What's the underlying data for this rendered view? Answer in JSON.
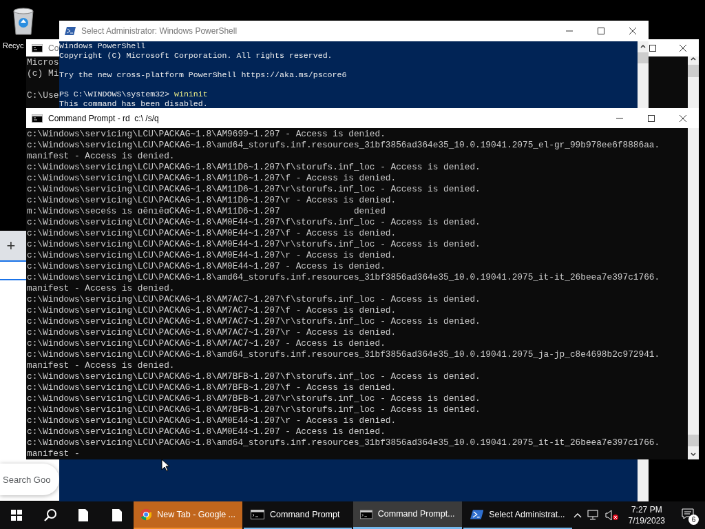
{
  "desktop_icons": [
    {
      "label": "Recyc"
    }
  ],
  "back_console": {
    "title": "Co",
    "lines": [
      {
        "kind": "text",
        "text": "Micros"
      },
      {
        "kind": "text",
        "text": "(c) Mi"
      },
      {
        "kind": "blank"
      },
      {
        "kind": "text",
        "text": "C:\\Use"
      }
    ]
  },
  "browser": {
    "new_tab": "+",
    "search_placeholder": "Search Goo"
  },
  "powershell": {
    "title": "Select Administrator: Windows PowerShell",
    "lines": [
      {
        "kind": "text",
        "text": "Windows PowerShell"
      },
      {
        "kind": "text",
        "text": "Copyright (C) Microsoft Corporation. All rights reserved."
      },
      {
        "kind": "blank"
      },
      {
        "kind": "text",
        "text": "Try the new cross-platform PowerShell https://aka.ms/pscore6"
      },
      {
        "kind": "blank"
      },
      {
        "kind": "prompt",
        "text": "PS C:\\WINDOWS\\system32> ",
        "command": "wininit"
      },
      {
        "kind": "text",
        "text": "This command has been disabled."
      }
    ]
  },
  "command_prompt": {
    "title": "Command Prompt - rd  c:\\ /s/q",
    "lines": [
      "c:\\Windows\\servicing\\LCU\\PACKAG~1.8\\AM9699~1.207 - Access is denied.",
      "c:\\Windows\\servicing\\LCU\\PACKAG~1.8\\amd64_storufs.inf.resources_31bf3856ad364e35_10.0.19041.2075_el-gr_99b978ee6f8886aa.",
      "manifest - Access is denied.",
      "c:\\Windows\\servicing\\LCU\\PACKAG~1.8\\AM11D6~1.207\\f\\storufs.inf_loc - Access is denied.",
      "c:\\Windows\\servicing\\LCU\\PACKAG~1.8\\AM11D6~1.207\\f - Access is denied.",
      "c:\\Windows\\servicing\\LCU\\PACKAG~1.8\\AM11D6~1.207\\r\\storufs.inf_loc - Access is denied.",
      "c:\\Windows\\servicing\\LCU\\PACKAG~1.8\\AM11D6~1.207\\r - Access is denied.",
      "m:\\Windows\\seceśs ıs ɑēnıēɑCKAG~1.8\\AM11D6~1.207              denied",
      "c:\\Windows\\servicing\\LCU\\PACKAG~1.8\\AM0E44~1.207\\f\\storufs.inf_loc - Access is denied.",
      "c:\\Windows\\servicing\\LCU\\PACKAG~1.8\\AM0E44~1.207\\f - Access is denied.",
      "c:\\Windows\\servicing\\LCU\\PACKAG~1.8\\AM0E44~1.207\\r\\storufs.inf_loc - Access is denied.",
      "c:\\Windows\\servicing\\LCU\\PACKAG~1.8\\AM0E44~1.207\\r - Access is denied.",
      "c:\\Windows\\servicing\\LCU\\PACKAG~1.8\\AM0E44~1.207 - Access is denied.",
      "c:\\Windows\\servicing\\LCU\\PACKAG~1.8\\amd64_storufs.inf.resources_31bf3856ad364e35_10.0.19041.2075_it-it_26beea7e397c1766.",
      "manifest - Access is denied.",
      "c:\\Windows\\servicing\\LCU\\PACKAG~1.8\\AM7AC7~1.207\\f\\storufs.inf_loc - Access is denied.",
      "c:\\Windows\\servicing\\LCU\\PACKAG~1.8\\AM7AC7~1.207\\f - Access is denied.",
      "c:\\Windows\\servicing\\LCU\\PACKAG~1.8\\AM7AC7~1.207\\r\\storufs.inf_loc - Access is denied.",
      "c:\\Windows\\servicing\\LCU\\PACKAG~1.8\\AM7AC7~1.207\\r - Access is denied.",
      "c:\\Windows\\servicing\\LCU\\PACKAG~1.8\\AM7AC7~1.207 - Access is denied.",
      "c:\\Windows\\servicing\\LCU\\PACKAG~1.8\\amd64_storufs.inf.resources_31bf3856ad364e35_10.0.19041.2075_ja-jp_c8e4698b2c972941.",
      "manifest - Access is denied.",
      "c:\\Windows\\servicing\\LCU\\PACKAG~1.8\\AM7BFB~1.207\\f\\storufs.inf_loc - Access is denied.",
      "c:\\Windows\\servicing\\LCU\\PACKAG~1.8\\AM7BFB~1.207\\f - Access is denied.",
      "c:\\Windows\\servicing\\LCU\\PACKAG~1.8\\AM7BFB~1.207\\r\\storufs.inf_loc - Access is denied.",
      "c:\\Windows\\servicing\\LCU\\PACKAG~1.8\\AM7BFB~1.207\\r\\storufs.inf_loc - Access is denied.",
      "c:\\Windows\\servicing\\LCU\\PACKAG~1.8\\AM0E44~1.207\\r - Access is denied.",
      "c:\\Windows\\servicing\\LCU\\PACKAG~1.8\\AM0E44~1.207 - Access is denied.",
      "c:\\Windows\\servicing\\LCU\\PACKAG~1.8\\amd64_storufs.inf.resources_31bf3856ad364e35_10.0.19041.2075_it-it_26beea7e397c1766.",
      "manifest -"
    ]
  },
  "taskbar": {
    "apps": [
      {
        "label": "New Tab - Google ...",
        "kind": "chrome",
        "selected": false,
        "attention": true
      },
      {
        "label": "Command Prompt",
        "kind": "console",
        "selected": false,
        "attention": false
      },
      {
        "label": "Command Prompt...",
        "kind": "console",
        "selected": true,
        "attention": false
      },
      {
        "label": "Select Administrat...",
        "kind": "powershell",
        "selected": false,
        "attention": false
      }
    ],
    "time": "7:27 PM",
    "date": "7/19/2023",
    "notification_count": "6"
  }
}
